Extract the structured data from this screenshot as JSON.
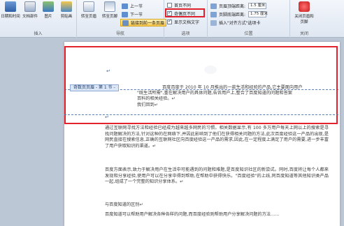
{
  "ribbon": {
    "insert_group": {
      "label": "插入",
      "buttons": [
        {
          "label": "日期和时间",
          "icon": "calendar-icon"
        },
        {
          "label": "文档部件",
          "icon": "document-parts-icon"
        },
        {
          "label": "图片",
          "icon": "picture-icon"
        },
        {
          "label": "剪贴画",
          "icon": "clipart-icon"
        }
      ]
    },
    "nav_group": {
      "label": "导航",
      "buttons": [
        {
          "label": "转至页眉",
          "icon": "goto-header-icon"
        },
        {
          "label": "转至页脚",
          "icon": "goto-footer-icon"
        }
      ],
      "small": [
        {
          "label": "上一节",
          "icon": "prev-section-icon"
        },
        {
          "label": "下一节",
          "icon": "next-section-icon"
        },
        {
          "label": "链接到前一条页眉",
          "icon": "link-previous-icon"
        }
      ]
    },
    "options_group": {
      "label": "选项",
      "items": [
        {
          "label": "首页不同",
          "checked": false
        },
        {
          "label": "奇偶页不同",
          "checked": true
        },
        {
          "label": "显示文档文字",
          "checked": true
        }
      ]
    },
    "position_group": {
      "label": "位置",
      "rows": [
        {
          "label": "页眉顶端距离:",
          "value": "1.5 厘米"
        },
        {
          "label": "页脚底端距离:",
          "value": "1.75 厘米"
        },
        {
          "label": "插入\"对齐方式\"选项卡",
          "value": ""
        }
      ]
    },
    "close_group": {
      "label": "关闭",
      "button": "关闭页眉和页脚"
    }
  },
  "document": {
    "header_label": "奇数页页眉 - 第 1 节 -",
    "header_lines": [
      "百度百度于 2010 年 10 月推出的一款生活和经验的产品,它主要面向用户",
      "\"既生活所需\",重在解决用户的具体问题,告诉用户上,整合了百度知道的问题和答案",
      "百科的相关经验。↵",
      "我们回到↵"
    ],
    "body_paragraphs": [
      "通过互联网寻找方法和经验已经成为越来越多网民的习惯。相关数据显示,有 100 多万用户每天上网以上的搜索是寻找问题解决的方法,针对这种的在网络下,并因此影响到了他们在获得相关问题的方法,此次百度经验这一产品的出现,是网民直接在搜索信息,正确的互联网社区向百度经验这一产品的需求,因此,在一定程度上满足了用户的需要,进一步丰富了用户获取知识的渠道。↵",
      "百度方面表示,致力于解决用户在生活中可能遇到的问题和难题,是百度知识社区的新尝试。同时,百度将让每个人都来发现和分享经验,使用户可以在分享中得到帮助,在帮助中获得快乐。\"百度经验\"的上线,同百度知道等其他知识类产品一起,组成了一个完整的知识分享体系。↵",
      "与百度知道的区别↵",
      "百度知道可以帮助用户解决各种各样的问题,而百度经验则帮助用户分享解决问题的方法……"
    ]
  }
}
